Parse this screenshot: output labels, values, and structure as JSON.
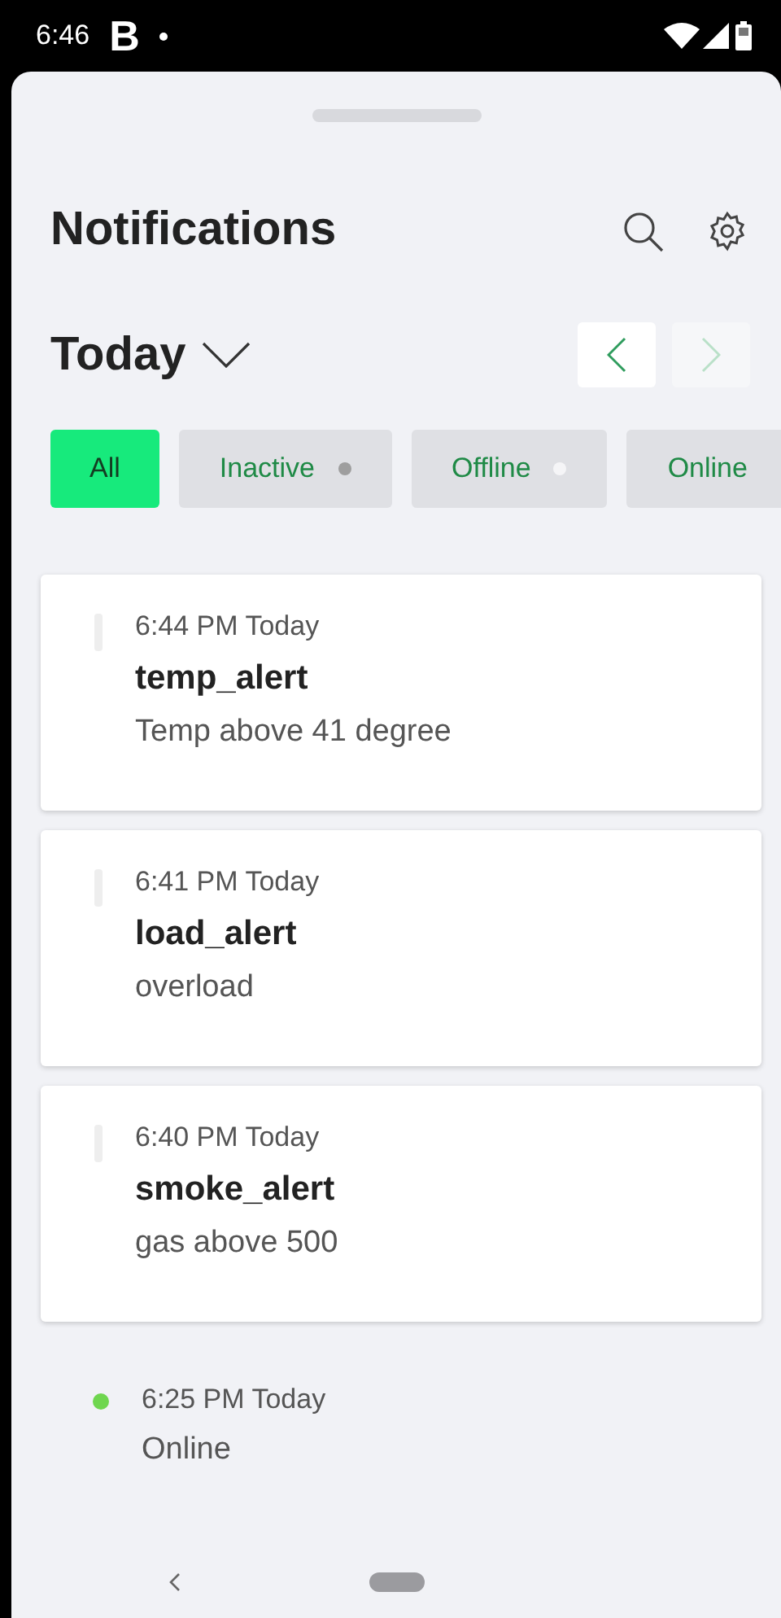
{
  "status_bar": {
    "time": "6:46",
    "app_badge": "B"
  },
  "header": {
    "title": "Notifications"
  },
  "period": {
    "label": "Today",
    "prev": {
      "disabled": false
    },
    "next": {
      "disabled": true
    }
  },
  "filters": [
    {
      "label": "All",
      "selected": true
    },
    {
      "label": "Inactive",
      "selected": false,
      "color": "#9e9e9e"
    },
    {
      "label": "Offline",
      "selected": false,
      "color": "#f5f5f7"
    },
    {
      "label": "Online",
      "selected": false
    }
  ],
  "notifications": [
    {
      "kind": "card",
      "color": "#eeeeee",
      "time": "6:44 PM Today",
      "title": "temp_alert",
      "message": "Temp above 41 degree"
    },
    {
      "kind": "card",
      "color": "#eeeeee",
      "time": "6:41 PM Today",
      "title": "load_alert",
      "message": "overload"
    },
    {
      "kind": "card",
      "color": "#eeeeee",
      "time": "6:40 PM Today",
      "title": "smoke_alert",
      "message": "gas above 500"
    },
    {
      "kind": "plain",
      "color": "#6fd64f",
      "time": "6:25 PM Today",
      "message": "Online"
    }
  ]
}
